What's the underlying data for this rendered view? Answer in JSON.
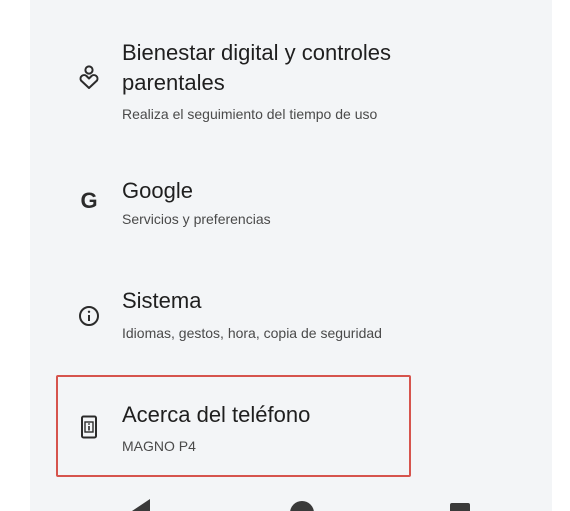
{
  "settings": {
    "items": [
      {
        "icon": "digital-wellbeing-icon",
        "title_line1": "Bienestar digital y controles",
        "title_line2": "parentales",
        "subtitle": "Realiza el seguimiento del tiempo de uso"
      },
      {
        "icon": "google-icon",
        "icon_glyph": "G",
        "title": "Google",
        "subtitle": "Servicios y preferencias"
      },
      {
        "icon": "info-icon",
        "title": "Sistema",
        "subtitle": "Idiomas, gestos, hora, copia de seguridad"
      },
      {
        "icon": "phone-info-icon",
        "title": "Acerca del teléfono",
        "subtitle": "MAGNO P4",
        "highlighted": true
      }
    ]
  },
  "navbar": {
    "buttons": [
      "back-icon",
      "home-icon",
      "recents-icon"
    ]
  },
  "colors": {
    "background": "#f3f5f7",
    "highlight_border": "#d6544d",
    "text_primary": "#1f1f1f",
    "text_secondary": "#4a4a4a"
  }
}
